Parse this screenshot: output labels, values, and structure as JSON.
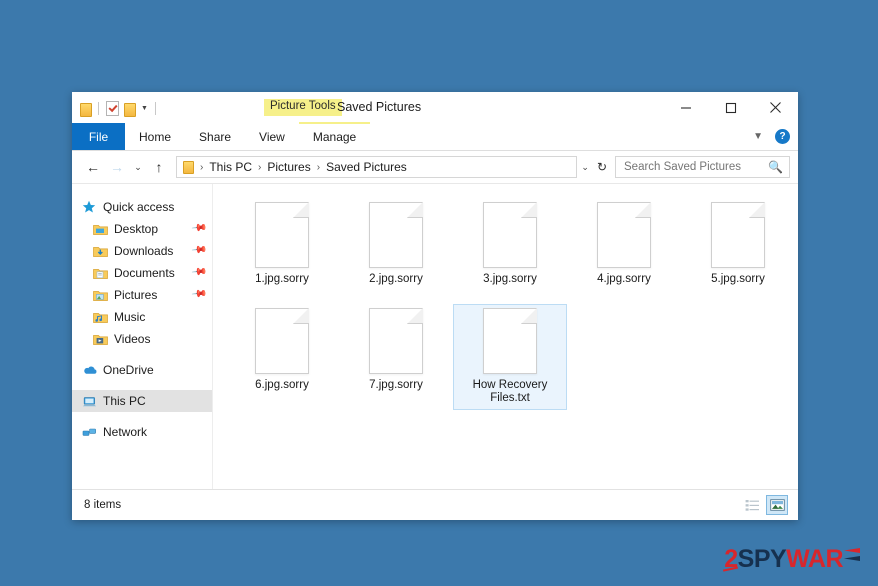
{
  "desktop": {
    "background_color": "#3c79ac"
  },
  "window": {
    "title": "Saved Pictures",
    "contextual_tab_label": "Picture Tools",
    "quick_access": [
      {
        "name": "folder-icon",
        "label": "Folder"
      },
      {
        "name": "properties-icon",
        "label": "Properties"
      },
      {
        "name": "new-folder-icon",
        "label": "New folder"
      },
      {
        "name": "customize-caret",
        "label": "Customize Quick Access Toolbar"
      }
    ],
    "controls": {
      "minimize": "Minimize",
      "maximize": "Maximize",
      "close": "Close",
      "collapse_ribbon": "Minimize the Ribbon",
      "help": "?"
    }
  },
  "ribbon": {
    "tabs": [
      {
        "label": "File",
        "active": true
      },
      {
        "label": "Home",
        "active": false
      },
      {
        "label": "Share",
        "active": false
      },
      {
        "label": "View",
        "active": false
      },
      {
        "label": "Manage",
        "active": false
      }
    ]
  },
  "addressbar": {
    "back": "←",
    "forward": "→",
    "recent": "⌄",
    "up": "↑",
    "breadcrumbs": [
      "This PC",
      "Pictures",
      "Saved Pictures"
    ],
    "separator": "›",
    "dropdown": "⌄",
    "refresh": "↻"
  },
  "search": {
    "placeholder": "Search Saved Pictures",
    "value": "",
    "icon": "search-icon"
  },
  "sidebar": {
    "items": [
      {
        "label": "Quick access",
        "icon": "star-icon",
        "indent": false,
        "pinned": false,
        "selected": false
      },
      {
        "label": "Desktop",
        "icon": "desktop-folder-icon",
        "indent": true,
        "pinned": true,
        "selected": false
      },
      {
        "label": "Downloads",
        "icon": "downloads-folder-icon",
        "indent": true,
        "pinned": true,
        "selected": false
      },
      {
        "label": "Documents",
        "icon": "documents-folder-icon",
        "indent": true,
        "pinned": true,
        "selected": false
      },
      {
        "label": "Pictures",
        "icon": "pictures-folder-icon",
        "indent": true,
        "pinned": true,
        "selected": false
      },
      {
        "label": "Music",
        "icon": "music-folder-icon",
        "indent": true,
        "pinned": false,
        "selected": false
      },
      {
        "label": "Videos",
        "icon": "videos-folder-icon",
        "indent": true,
        "pinned": false,
        "selected": false
      },
      {
        "label": "OneDrive",
        "icon": "onedrive-icon",
        "indent": false,
        "pinned": false,
        "selected": false
      },
      {
        "label": "This PC",
        "icon": "this-pc-icon",
        "indent": false,
        "pinned": false,
        "selected": true
      },
      {
        "label": "Network",
        "icon": "network-icon",
        "indent": false,
        "pinned": false,
        "selected": false
      }
    ],
    "pin_glyph": "📌"
  },
  "files": [
    {
      "name": "1.jpg.sorry",
      "selected": false
    },
    {
      "name": "2.jpg.sorry",
      "selected": false
    },
    {
      "name": "3.jpg.sorry",
      "selected": false
    },
    {
      "name": "4.jpg.sorry",
      "selected": false
    },
    {
      "name": "5.jpg.sorry",
      "selected": false
    },
    {
      "name": "6.jpg.sorry",
      "selected": false
    },
    {
      "name": "7.jpg.sorry",
      "selected": false
    },
    {
      "name": "How Recovery Files.txt",
      "selected": true
    }
  ],
  "statusbar": {
    "item_count": "8 items",
    "views": [
      {
        "name": "details-view-button",
        "label": "Details view",
        "active": false
      },
      {
        "name": "large-icons-view-button",
        "label": "Large icons view",
        "active": true
      }
    ]
  },
  "watermark": {
    "part1": "2",
    "part2": "SPY",
    "part3": "WAR",
    "colors": {
      "red": "#d8262c",
      "navy": "#16304e"
    }
  }
}
